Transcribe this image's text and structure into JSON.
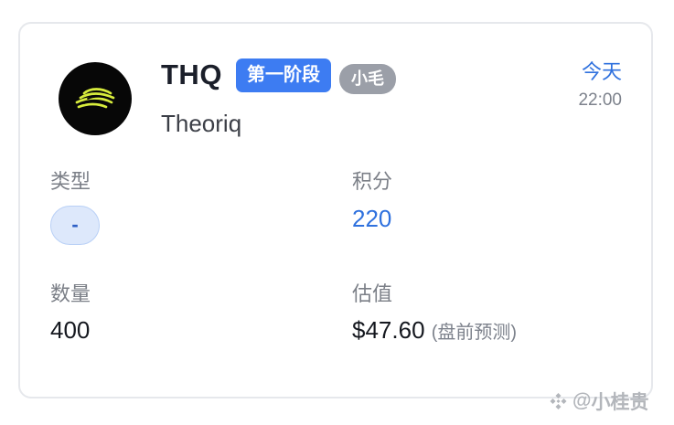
{
  "card": {
    "logo_icon": "theoriq-logo-icon",
    "ticker": "THQ",
    "phase_badge": "第一阶段",
    "author_badge": "小毛",
    "project_name": "Theoriq",
    "date_label": "今天",
    "time": "22:00"
  },
  "fields": {
    "type_label": "类型",
    "type_value": "-",
    "points_label": "积分",
    "points_value": "220",
    "quantity_label": "数量",
    "quantity_value": "400",
    "valuation_label": "估值",
    "valuation_value": "$47.60",
    "valuation_note": "(盘前预测)"
  },
  "watermark": {
    "icon": "binance-logo-icon",
    "separator": "@",
    "author": "小桂贵"
  },
  "colors": {
    "accent": "#2f71de",
    "phase_badge": "#3d7cf2",
    "author_badge": "#9b9fa8",
    "logo_background": "#070707",
    "logo_stripes": "#d7ec3c"
  }
}
